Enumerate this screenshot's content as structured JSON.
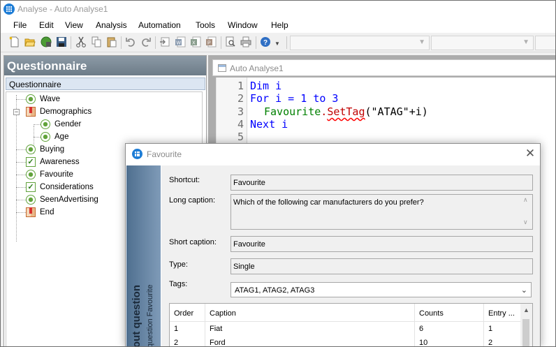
{
  "window": {
    "title": "Analyse - Auto Analyse1"
  },
  "menu": [
    "File",
    "Edit",
    "View",
    "Analysis",
    "Automation",
    "Tools",
    "Window",
    "Help"
  ],
  "questionnaire": {
    "header": "Questionnaire",
    "subheader": "Questionnaire",
    "items": [
      {
        "label": "Wave",
        "icon": "radio-icon"
      },
      {
        "label": "Demographics",
        "icon": "book-icon"
      },
      {
        "label": "Gender",
        "icon": "radio-icon"
      },
      {
        "label": "Age",
        "icon": "radio-icon"
      },
      {
        "label": "Buying",
        "icon": "radio-icon"
      },
      {
        "label": "Awareness",
        "icon": "check-icon"
      },
      {
        "label": "Favourite",
        "icon": "radio-icon"
      },
      {
        "label": "Considerations",
        "icon": "check-icon"
      },
      {
        "label": "SeenAdvertising",
        "icon": "radio-icon"
      },
      {
        "label": "End",
        "icon": "book-icon"
      }
    ]
  },
  "document": {
    "title": "Auto Analyse1",
    "line_numbers": [
      "1",
      "2",
      "3",
      "4",
      "5"
    ],
    "code": {
      "l1_kw": "Dim",
      "l1_rest": " i",
      "l2_kw": "For",
      "l2_mid": " i = 1 ",
      "l2_kw2": "to",
      "l2_rest": " 3",
      "l3_obj": "Favourite",
      "l3_dot": ".",
      "l3_method": "SetTag",
      "l3_rest": "(\"ATAG\"+i)",
      "l4_kw": "Next",
      "l4_rest": " i"
    }
  },
  "dialog": {
    "title": "Favourite",
    "side_main": "out question",
    "side_sub": "question Favourite",
    "shortcut_label": "Shortcut:",
    "shortcut_value": "Favourite",
    "long_caption_label": "Long caption:",
    "long_caption_value": "Which of the following car manufacturers do you prefer?",
    "short_caption_label": "Short caption:",
    "short_caption_value": "Favourite",
    "type_label": "Type:",
    "type_value": "Single",
    "tags_label": "Tags:",
    "tags_value": "ATAG1, ATAG2, ATAG3",
    "grid": {
      "columns": [
        "Order",
        "Caption",
        "Counts",
        "Entry ..."
      ],
      "rows": [
        [
          "1",
          "Fiat",
          "6",
          "1"
        ],
        [
          "2",
          "Ford",
          "10",
          "2"
        ]
      ]
    }
  },
  "colors": {
    "keyword": "#0000ff",
    "object": "#008000",
    "method": "#c00000",
    "panel_header": "#6d7c88"
  }
}
